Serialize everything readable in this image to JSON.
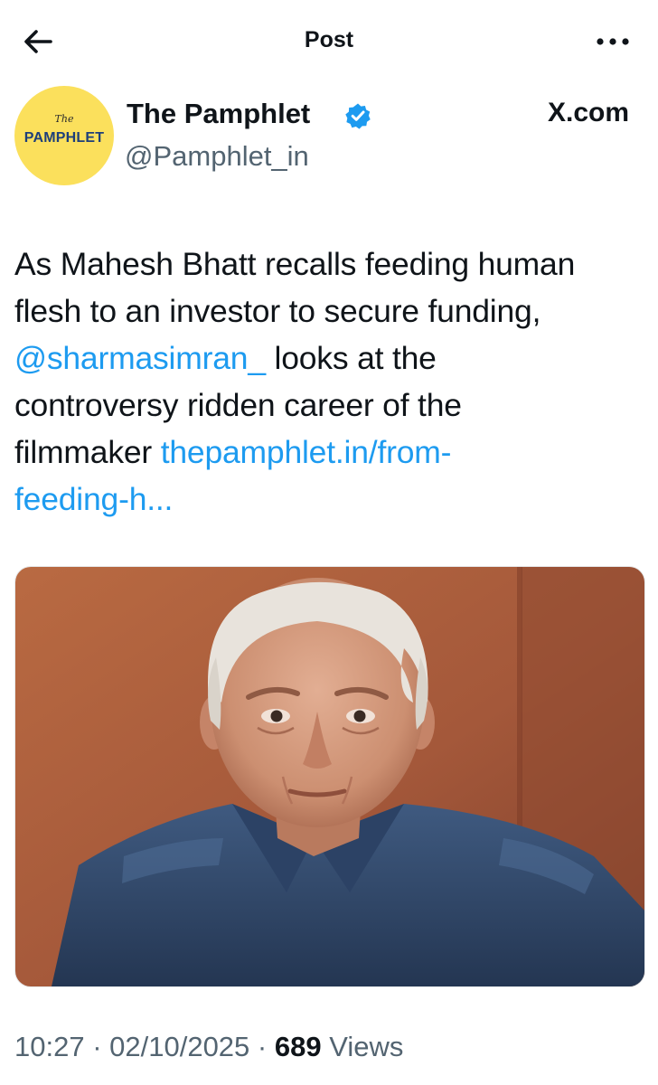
{
  "header": {
    "title": "Post",
    "back_icon": "arrow-left-icon",
    "more_icon": "more-horizontal-icon"
  },
  "author": {
    "name": "The Pamphlet",
    "handle": "@Pamphlet_in",
    "verified": true,
    "avatar": {
      "logo_the": "The",
      "logo_word": "PAMPHLET",
      "bg_color": "#fbe05c"
    }
  },
  "source_label": "X.com",
  "tweet": {
    "line1": "As Mahesh Bhatt recalls feeding human",
    "line2": "flesh to an investor to secure funding,",
    "mention": "@sharmasimran_",
    "line3_rest": " looks at the",
    "line4": "controversy ridden career of the",
    "line5_text": "filmmaker ",
    "link_part1": "thepamphlet.in/from-",
    "link_part2": "feeding-h..."
  },
  "media": {
    "type": "photo"
  },
  "meta": {
    "time": "10:27",
    "sep1": " · ",
    "date": "02/10/2025",
    "sep2": " · ",
    "views_count": "689",
    "views_label": " Views"
  },
  "colors": {
    "link": "#1d9bf0",
    "verified": "#1d9bf0",
    "secondary_text": "#536471"
  }
}
